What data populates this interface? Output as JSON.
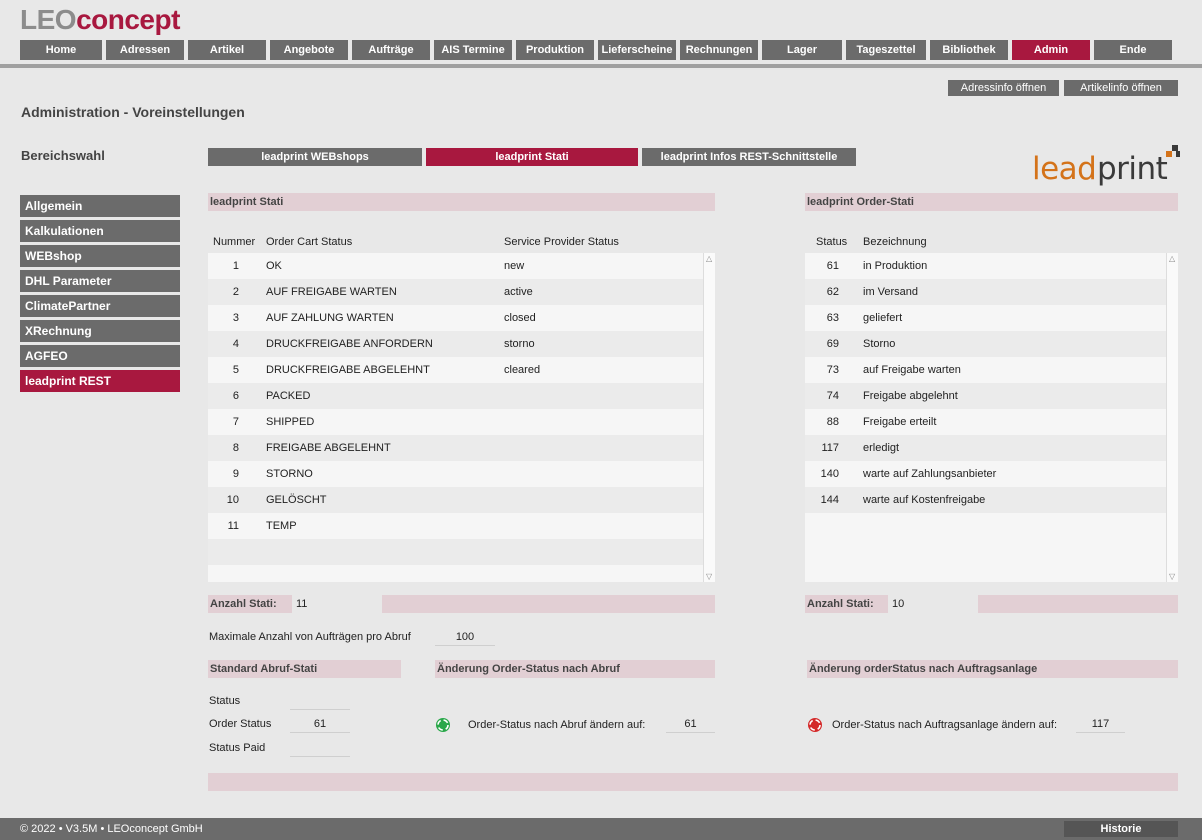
{
  "app": {
    "logo_a": "LEO",
    "logo_b": "concept"
  },
  "nav": [
    "Home",
    "Adressen",
    "Artikel",
    "Angebote",
    "Aufträge",
    "AIS Termine",
    "Produktion",
    "Lieferscheine",
    "Rechnungen",
    "Lager",
    "Tageszettel",
    "Bibliothek",
    "Admin",
    "Ende"
  ],
  "nav_active": "Admin",
  "top_buttons": {
    "adress": "Adressinfo öffnen",
    "artikel": "Artikelinfo öffnen"
  },
  "page_title": "Administration - Voreinstellungen",
  "section_title": "Bereichswahl",
  "sidebar": [
    "Allgemein",
    "Kalkulationen",
    "WEBshop",
    "DHL Parameter",
    "ClimatePartner",
    "XRechnung",
    "AGFEO",
    "leadprint REST"
  ],
  "sidebar_active": "leadprint REST",
  "tabs": [
    "leadprint WEBshops",
    "leadprint Stati",
    "leadprint Infos REST-Schnittstelle"
  ],
  "tab_active": "leadprint Stati",
  "brand": {
    "lead": "lead",
    "print": "print"
  },
  "stati": {
    "title": "leadprint Stati",
    "headers": [
      "Nummer",
      "Order Cart Status",
      "Service Provider Status"
    ],
    "rows": [
      [
        "1",
        "OK",
        "new"
      ],
      [
        "2",
        "AUF FREIGABE WARTEN",
        "active"
      ],
      [
        "3",
        "AUF ZAHLUNG WARTEN",
        "closed"
      ],
      [
        "4",
        "DRUCKFREIGABE ANFORDERN",
        "storno"
      ],
      [
        "5",
        "DRUCKFREIGABE ABGELEHNT",
        "cleared"
      ],
      [
        "6",
        "PACKED",
        ""
      ],
      [
        "7",
        "SHIPPED",
        ""
      ],
      [
        "8",
        "FREIGABE ABGELEHNT",
        ""
      ],
      [
        "9",
        "STORNO",
        ""
      ],
      [
        "10",
        "GELÖSCHT",
        ""
      ],
      [
        "11",
        "TEMP",
        ""
      ]
    ],
    "count_label": "Anzahl Stati:",
    "count": "11"
  },
  "order_stati": {
    "title": "leadprint Order-Stati",
    "headers": [
      "Status",
      "Bezeichnung"
    ],
    "rows": [
      [
        "61",
        "in Produktion"
      ],
      [
        "62",
        "im Versand"
      ],
      [
        "63",
        "geliefert"
      ],
      [
        "69",
        "Storno"
      ],
      [
        "73",
        "auf Freigabe warten"
      ],
      [
        "74",
        "Freigabe abgelehnt"
      ],
      [
        "88",
        "Freigabe erteilt"
      ],
      [
        "117",
        "erledigt"
      ],
      [
        "140",
        "warte auf Zahlungsanbieter"
      ],
      [
        "144",
        "warte auf Kostenfreigabe"
      ]
    ],
    "count_label": "Anzahl Stati:",
    "count": "10"
  },
  "max_orders": {
    "label": "Maximale Anzahl von Aufträgen pro Abruf",
    "value": "100"
  },
  "standard": {
    "title": "Standard Abruf-Stati",
    "status_label": "Status",
    "status_value": "",
    "order_status_label": "Order Status",
    "order_status_value": "61",
    "status_paid_label": "Status Paid",
    "status_paid_value": ""
  },
  "change_abruf": {
    "title": "Änderung Order-Status nach Abruf",
    "label": "Order-Status nach Abruf ändern auf:",
    "value": "61",
    "icon_color": "#2aa84a"
  },
  "change_anlage": {
    "title": "Änderung orderStatus nach Auftragsanlage",
    "label": "Order-Status nach Auftragsanlage ändern auf:",
    "value": "117",
    "icon_color": "#d42a2a"
  },
  "footer": {
    "text": "© 2022 • V3.5M • LEOconcept GmbH",
    "historie": "Historie"
  }
}
